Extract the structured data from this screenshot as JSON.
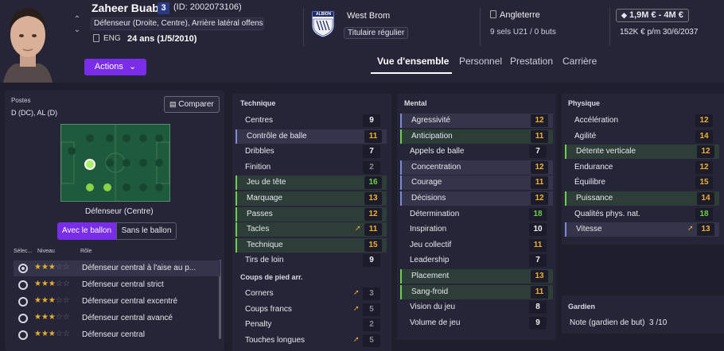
{
  "player": {
    "name": "Zaheer Buabo",
    "number": "3",
    "id_text": "(ID: 2002073106)",
    "positions_text": "Défenseur (Droite, Centre), Arrière latéral offensif ...",
    "nationality": "ENG",
    "age_text": "24 ans (1/5/2010)"
  },
  "actions_label": "Actions",
  "club": {
    "name": "West Brom",
    "status": "Titulaire régulier",
    "badge_text": "ALBION"
  },
  "intl": {
    "country": "Angleterre",
    "caps": "9 sels U21 / 0 buts"
  },
  "contract": {
    "value": "1,9M € - 4M €",
    "wage_text": "152K € p/m 30/6/2037"
  },
  "tabs": [
    "Vue d'ensemble",
    "Personnel",
    "Prestation",
    "Carrière"
  ],
  "left_panel": {
    "postes_label": "Postes",
    "postes_value": "D (DC), AL (D)",
    "compare_label": "Comparer",
    "pitch_caption": "Défenseur (Centre)",
    "toggle_with": "Avec le ballon",
    "toggle_without": "Sans le ballon",
    "col_select": "Sélec...",
    "col_level": "Niveau",
    "col_role": "Rôle",
    "roles": [
      {
        "name": "Défenseur central à l'aise au p...",
        "stars": 3,
        "selected": true
      },
      {
        "name": "Défenseur central strict",
        "stars": 3,
        "selected": false
      },
      {
        "name": "Défenseur central excentré",
        "stars": 3,
        "selected": false
      },
      {
        "name": "Défenseur central avancé",
        "stars": 3,
        "selected": false
      },
      {
        "name": "Défenseur central",
        "stars": 3,
        "selected": false
      }
    ]
  },
  "attributes": {
    "technique": {
      "title": "Technique",
      "items": [
        {
          "label": "Centres",
          "value": "9"
        },
        {
          "label": "Contrôle de balle",
          "value": "11"
        },
        {
          "label": "Dribbles",
          "value": "7"
        },
        {
          "label": "Finition",
          "value": "2"
        },
        {
          "label": "Jeu de tête",
          "value": "16"
        },
        {
          "label": "Marquage",
          "value": "13"
        },
        {
          "label": "Passes",
          "value": "12"
        },
        {
          "label": "Tacles",
          "value": "11"
        },
        {
          "label": "Technique",
          "value": "15"
        },
        {
          "label": "Tirs de loin",
          "value": "9"
        }
      ]
    },
    "setpieces": {
      "title": "Coups de pied arr.",
      "items": [
        {
          "label": "Corners",
          "value": "3"
        },
        {
          "label": "Coups francs",
          "value": "5"
        },
        {
          "label": "Penalty",
          "value": "2"
        },
        {
          "label": "Touches longues",
          "value": "5"
        }
      ]
    },
    "mental": {
      "title": "Mental",
      "items": [
        {
          "label": "Agressivité",
          "value": "12"
        },
        {
          "label": "Anticipation",
          "value": "11"
        },
        {
          "label": "Appels de balle",
          "value": "7"
        },
        {
          "label": "Concentration",
          "value": "12"
        },
        {
          "label": "Courage",
          "value": "11"
        },
        {
          "label": "Décisions",
          "value": "12"
        },
        {
          "label": "Détermination",
          "value": "18"
        },
        {
          "label": "Inspiration",
          "value": "10"
        },
        {
          "label": "Jeu collectif",
          "value": "11"
        },
        {
          "label": "Leadership",
          "value": "7"
        },
        {
          "label": "Placement",
          "value": "13"
        },
        {
          "label": "Sang-froid",
          "value": "11"
        },
        {
          "label": "Vision du jeu",
          "value": "8"
        },
        {
          "label": "Volume de jeu",
          "value": "9"
        }
      ]
    },
    "physique": {
      "title": "Physique",
      "items": [
        {
          "label": "Accélération",
          "value": "12"
        },
        {
          "label": "Agilité",
          "value": "14"
        },
        {
          "label": "Détente verticale",
          "value": "12"
        },
        {
          "label": "Endurance",
          "value": "12"
        },
        {
          "label": "Équilibre",
          "value": "15"
        },
        {
          "label": "Puissance",
          "value": "14"
        },
        {
          "label": "Qualités phys. nat.",
          "value": "18"
        },
        {
          "label": "Vitesse",
          "value": "13"
        }
      ]
    },
    "gardien": {
      "title": "Gardien",
      "note": "Note (gardien de but)  3 /10"
    }
  },
  "colors": {
    "accent": "#7a2de8",
    "val_low": "#8a8a96",
    "val_mid": "#f2f2f2",
    "val_good": "#f0b030",
    "val_high": "#6bd04a"
  }
}
